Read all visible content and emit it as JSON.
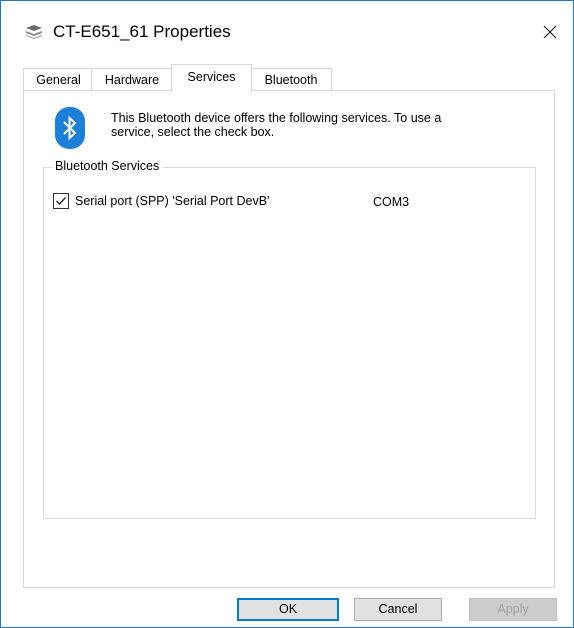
{
  "window": {
    "title": "CT-E651_61 Properties",
    "icon": "printer-icon",
    "close_icon": "close-icon",
    "border_color": "#1979ca"
  },
  "tabs": [
    {
      "label": "General",
      "active": false
    },
    {
      "label": "Hardware",
      "active": false
    },
    {
      "label": "Services",
      "active": true
    },
    {
      "label": "Bluetooth",
      "active": false
    }
  ],
  "services_panel": {
    "icon": "bluetooth-icon",
    "accent_color": "#1d7fd6",
    "description_line1": "This Bluetooth device offers the following services. To use a",
    "description_line2": "service, select the check box.",
    "group_label": "Bluetooth Services",
    "services": [
      {
        "name": "Serial port (SPP) 'Serial Port DevB'",
        "port": "COM3",
        "checked": true
      }
    ]
  },
  "buttons": {
    "ok": "OK",
    "cancel": "Cancel",
    "apply": "Apply"
  }
}
